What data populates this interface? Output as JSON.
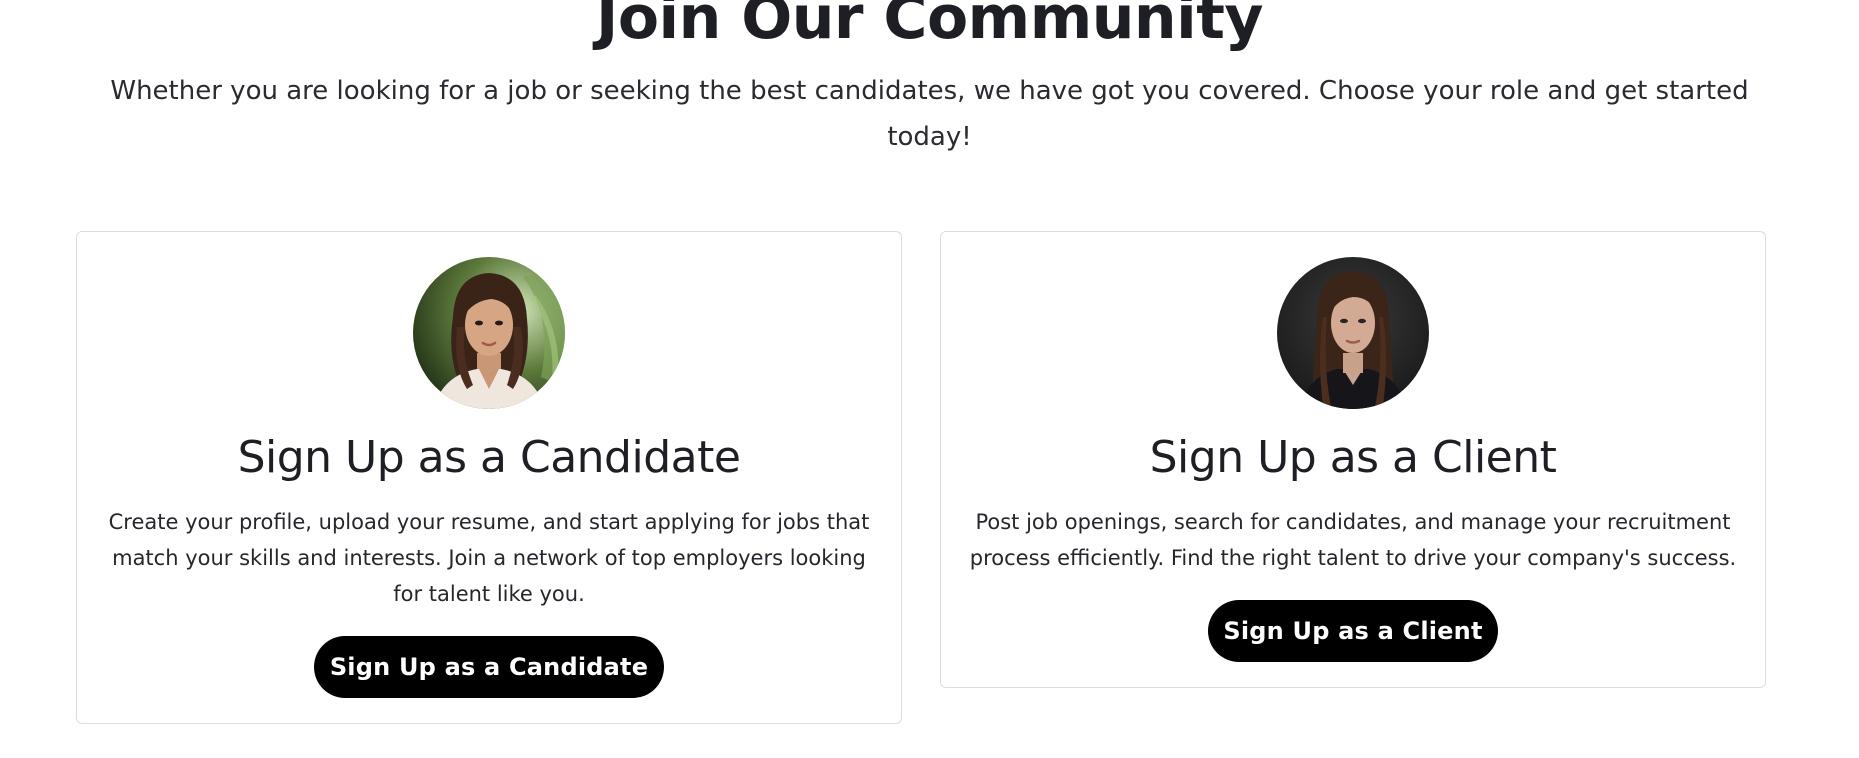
{
  "section": {
    "title": "Join Our Community",
    "subtitle": "Whether you are looking for a job or seeking the best candidates, we have got you covered. Choose your role and get started today!"
  },
  "cards": [
    {
      "title": "Sign Up as a Candidate",
      "description": "Create your profile, upload your resume, and start applying for jobs that match your skills and interests. Join a network of top employers looking for talent like you.",
      "button_label": "Sign Up as a Candidate",
      "avatar": "candidate-portrait"
    },
    {
      "title": "Sign Up as a Client",
      "description": "Post job openings, search for candidates, and manage your recruitment process efficiently. Find the right talent to drive your company's success.",
      "button_label": "Sign Up as a Client",
      "avatar": "client-portrait"
    }
  ],
  "colors": {
    "text": "#1e1f24",
    "button_bg": "#000000",
    "button_text": "#ffffff",
    "card_border": "#dcdde0",
    "background": "#ffffff"
  }
}
